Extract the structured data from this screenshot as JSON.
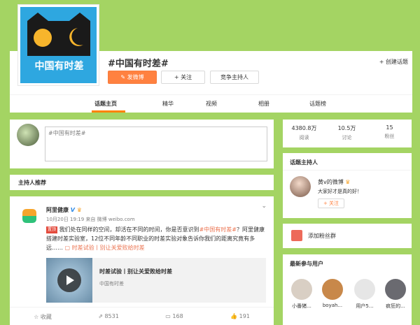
{
  "header": {
    "topic_title": "#中国有时差#",
    "avatar_text": "中国有时差",
    "post_button": "发微博",
    "follow_button": "+ 关注",
    "host_button": "竞争主持人",
    "create_topic": "+ 创建话题",
    "tabs": [
      {
        "label": "话题主页",
        "active": true
      },
      {
        "label": "精华",
        "active": false
      },
      {
        "label": "视频",
        "active": false
      },
      {
        "label": "相册",
        "active": false
      },
      {
        "label": "话题榜",
        "active": false
      }
    ]
  },
  "composer": {
    "value": "#中国有时差#"
  },
  "host_recommend": {
    "label": "主持人推荐"
  },
  "post": {
    "author": "阿里健康",
    "verified_mark": "V",
    "meta": "10月20日 19:19 来自 微博 weibo.com",
    "hot_tag": "置顶",
    "text_1": "我们处在同样的空间，却活在不同的时间，你是否意识到",
    "topic_link": "#中国有时差#",
    "text_2": "？阿里健康搭建时差实验室，12位不同年龄不同职业的时差实验对象告诉你我们的距离究竟有多远……",
    "video_link": "时差试验丨别让关爱败给时差",
    "link_card": {
      "title": "时差试验丨别让关爱败给时差",
      "subtitle": "中国有时差"
    },
    "actions": [
      {
        "icon": "star-icon",
        "label": "收藏"
      },
      {
        "icon": "share-icon",
        "label": "8531"
      },
      {
        "icon": "comment-icon",
        "label": "168"
      },
      {
        "icon": "like-icon",
        "label": "191"
      }
    ]
  },
  "stats": [
    {
      "value": "4380.8万",
      "label": "阅读"
    },
    {
      "value": "10.5万",
      "label": "讨论"
    },
    {
      "value": "15",
      "label": "粉丝"
    }
  ],
  "hosts": {
    "title": "话题主持人",
    "name": "黄v的微博",
    "desc": "大家好才是真的好！",
    "follow": "+ 关注"
  },
  "fans": {
    "label": "添加粉丝群"
  },
  "users": {
    "title": "最新参与用户",
    "items": [
      {
        "name": "小番猪...",
        "color": "#d9cfc4"
      },
      {
        "name": "boyah...",
        "color": "#c8884a"
      },
      {
        "name": "用户5...",
        "color": "#e6e6e6"
      },
      {
        "name": "疯狂的...",
        "color": "#6a6a70"
      }
    ]
  },
  "colors": {
    "background": "#a4d463",
    "accent": "#ff8140",
    "avatar_bg": "#2ea7e0"
  }
}
